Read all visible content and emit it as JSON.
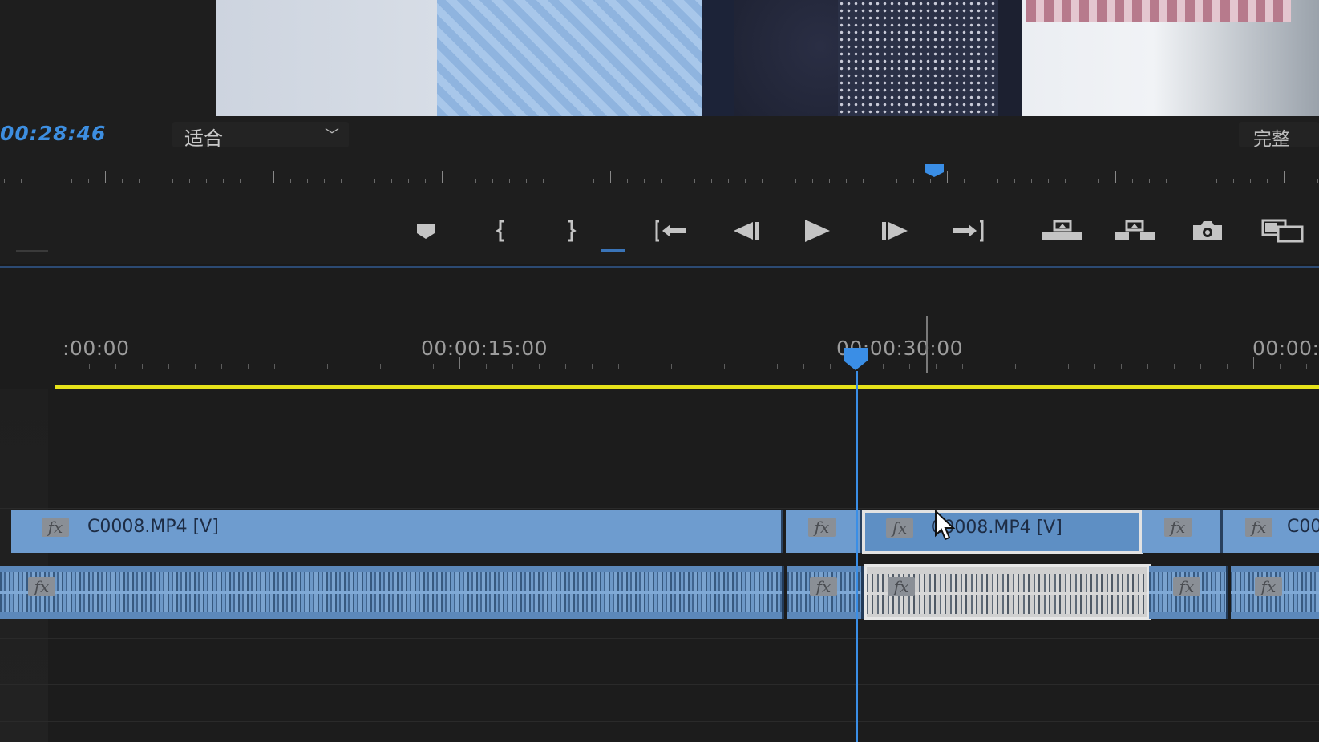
{
  "monitor": {
    "timecode": "00:28:46",
    "fit_label": "适合",
    "quality_label": "完整"
  },
  "transport": {
    "buttons": [
      {
        "name": "add-marker-button",
        "icon": "marker-icon"
      },
      {
        "name": "mark-in-button",
        "icon": "mark-in-icon"
      },
      {
        "name": "mark-out-button",
        "icon": "mark-out-icon"
      },
      {
        "name": "go-to-in-button",
        "icon": "go-to-in-icon"
      },
      {
        "name": "step-back-button",
        "icon": "step-back-icon"
      },
      {
        "name": "play-button",
        "icon": "play-icon"
      },
      {
        "name": "step-forward-button",
        "icon": "step-forward-icon"
      },
      {
        "name": "go-to-out-button",
        "icon": "go-to-out-icon"
      },
      {
        "name": "lift-button",
        "icon": "lift-icon"
      },
      {
        "name": "extract-button",
        "icon": "extract-icon"
      },
      {
        "name": "export-frame-button",
        "icon": "camera-icon"
      },
      {
        "name": "comparison-view-button",
        "icon": "comparison-icon"
      }
    ]
  },
  "timeline": {
    "ruler_labels": [
      ":00:00",
      "00:00:15:00",
      "00:00:30:00",
      "00:00:"
    ],
    "video_clips": [
      {
        "label": "C0008.MP4 [V]",
        "fx": "fx",
        "selected": false
      },
      {
        "label": "",
        "fx": "fx",
        "selected": false
      },
      {
        "label": "C0008.MP4 [V]",
        "fx": "fx",
        "selected": true
      },
      {
        "label": "",
        "fx": "fx",
        "selected": false
      },
      {
        "label": "C00",
        "fx": "fx",
        "selected": false
      }
    ],
    "audio_clips": [
      {
        "fx": "fx",
        "selected": false
      },
      {
        "fx": "fx",
        "selected": false
      },
      {
        "fx": "fx",
        "selected": true
      },
      {
        "fx": "fx",
        "selected": false
      },
      {
        "fx": "fx",
        "selected": false
      }
    ],
    "colors": {
      "clip": "#6e9ccf",
      "playhead": "#3a8ee6",
      "work_area": "#e6e21a",
      "timecode": "#3d8ee0"
    }
  }
}
